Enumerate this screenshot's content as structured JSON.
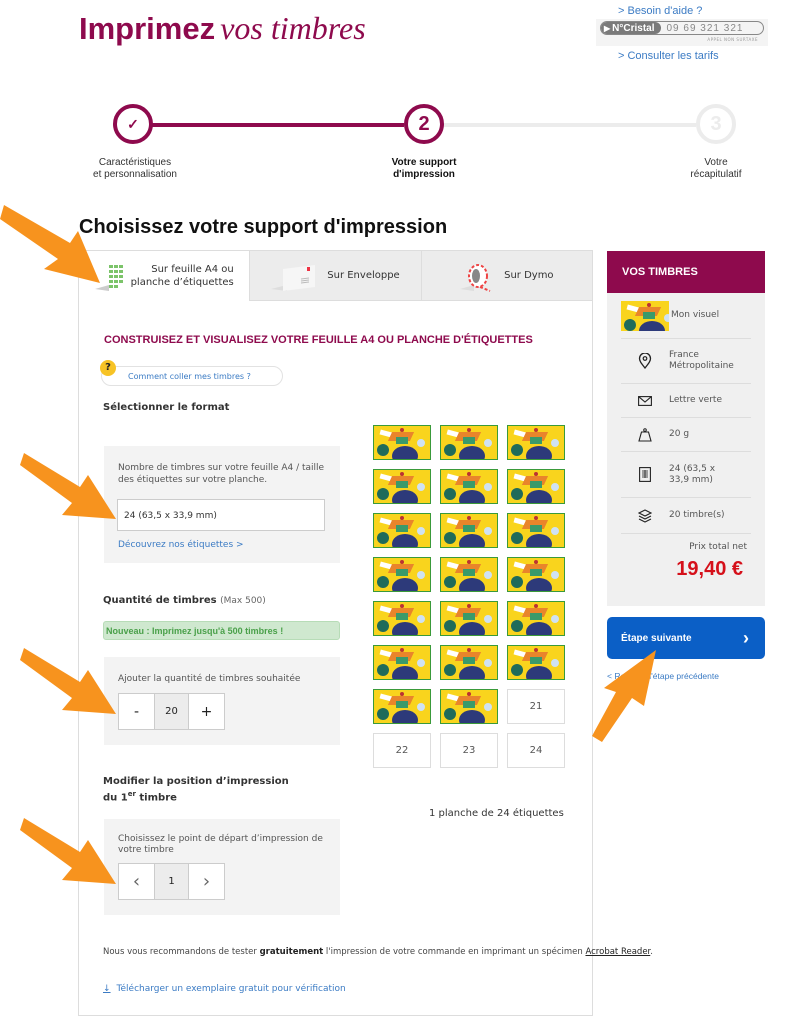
{
  "header": {
    "brand_bold": "Imprimez",
    "brand_italic": "vos timbres",
    "help_link": "> Besoin d'aide ?",
    "cristal_label": "N°Cristal",
    "cristal_number": "09 69 321 321",
    "cristal_sub": "APPEL NON SURTAXE",
    "tarifs_link": "> Consulter les tarifs"
  },
  "stepper": {
    "steps": [
      {
        "number": "✓",
        "label": "Caractéristiques\net personnalisation",
        "state": "done"
      },
      {
        "number": "2",
        "label": "Votre support\nd'impression",
        "state": "current"
      },
      {
        "number": "3",
        "label": "Votre\nrécapitulatif",
        "state": "upcoming"
      }
    ],
    "colors": {
      "active": "#8e0a4d",
      "inactive": "#ececec"
    }
  },
  "page_title": "Choisissez votre support d'impression",
  "tabs": [
    {
      "label": "Sur feuille A4 ou\nplanche d’étiquettes",
      "icon": "sheet-grid-icon",
      "active": true
    },
    {
      "label": "Sur Enveloppe",
      "icon": "envelope-icon",
      "active": false
    },
    {
      "label": "Sur Dymo",
      "icon": "dymo-roll-icon",
      "active": false
    }
  ],
  "main": {
    "section_title": "CONSTRUISEZ ET VISUALISEZ VOTRE FEUILLE A4 OU PLANCHE D'ÉTIQUETTES",
    "howto_link": "Comment coller mes timbres ?",
    "format_heading": "Sélectionner le format",
    "format_help": "Nombre de timbres sur votre feuille A4 / taille des étiquettes sur votre planche.",
    "format_value": "24 (63,5 x 33,9 mm)",
    "format_link": "Découvrez nos étiquettes >",
    "quantity_heading": "Quantité de timbres",
    "quantity_max": "(Max 500)",
    "quantity_notice": "Nouveau : Imprimez jusqu'à 500 timbres !",
    "quantity_help": "Ajouter la quantité de timbres souhaitée",
    "quantity_minus": "-",
    "quantity_value": "20",
    "quantity_plus": "+",
    "position_heading_1": "Modifier la position d’impression",
    "position_heading_2a": "du 1",
    "position_heading_sup": "er",
    "position_heading_2b": " timbre",
    "position_help": "Choisissez le point de départ d’impression de votre timbre",
    "position_prev": "‹",
    "position_value": "1",
    "position_next": "›",
    "sheet_summary": "1 planche de 24 étiquettes",
    "reco_text_1": "Nous vous recommandons de tester ",
    "reco_bold": "gratuitement",
    "reco_text_2": " l'impression de votre commande en imprimant un spécimen ",
    "reco_link": "Acrobat Reader",
    "reco_text_3": ".",
    "download_link": "Télécharger un exemplaire gratuit pour vérification"
  },
  "sheet": {
    "total_cells": 24,
    "filled_stamps": 20,
    "empty_labels": [
      "21",
      "22",
      "23",
      "24"
    ]
  },
  "sidebar": {
    "title": "VOS TIMBRES",
    "rows": [
      {
        "icon": "stamp-thumbnail",
        "text": "Mon visuel"
      },
      {
        "icon": "location-pin-icon",
        "text": "France Métropolitaine"
      },
      {
        "icon": "envelope-icon",
        "text": "Lettre verte"
      },
      {
        "icon": "weight-icon",
        "text": "20 g"
      },
      {
        "icon": "sheet-icon",
        "text": "24 (63,5 x 33,9 mm)"
      },
      {
        "icon": "layers-icon",
        "text": "20 timbre(s)"
      }
    ],
    "price_label": "Prix total net",
    "price": "19,40 €",
    "next_button": "Étape suivante",
    "back_link": "< Retour à l'étape précédente"
  },
  "colors": {
    "brand": "#8e0a4d",
    "primary_button": "#0b5fc6",
    "link": "#3b7bc4",
    "price": "#d5101a",
    "notice_text": "#4aa04a",
    "annotation_arrow": "#f7931e"
  }
}
